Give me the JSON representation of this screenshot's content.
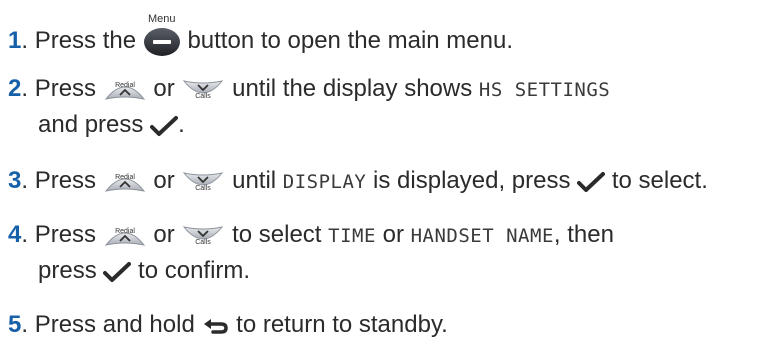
{
  "steps": [
    {
      "number": "1",
      "text_before": "Press the",
      "menu_caption": "Menu",
      "text_after": "button to open the main menu.",
      "icons": [
        "menu-button-icon"
      ]
    },
    {
      "number": "2",
      "text_press": "Press",
      "text_or": "or",
      "text_until": "until the display shows",
      "display_text": "HS SETTINGS",
      "line2_text": "and press",
      "line2_end": ".",
      "icons": [
        "redial-up-button-icon",
        "calls-down-button-icon",
        "ok-check-icon"
      ]
    },
    {
      "number": "3",
      "text_press": "Press",
      "text_or": "or",
      "text_until": "until",
      "display_text": "DISPLAY",
      "text_after": "is displayed, press",
      "text_end": "to select.",
      "icons": [
        "redial-up-button-icon",
        "calls-down-button-icon",
        "ok-check-icon"
      ]
    },
    {
      "number": "4",
      "text_press": "Press",
      "text_or": "or",
      "text_select": "to select",
      "display_text_1": "TIME",
      "text_or2": "or",
      "display_text_2": "HANDSET NAME",
      "text_then": ", then",
      "line2_text": "press",
      "line2_end": "to confirm.",
      "icons": [
        "redial-up-button-icon",
        "calls-down-button-icon",
        "ok-check-icon"
      ]
    },
    {
      "number": "5",
      "text_before": "Press and hold",
      "text_after": "to return to standby.",
      "icons": [
        "back-end-icon"
      ]
    }
  ],
  "button_labels": {
    "redial": "Redial",
    "calls": "Calls"
  },
  "colors": {
    "number": "#1560a8",
    "text": "#2b2b2b",
    "button_dark": "#3a3d44",
    "button_light": "#c9cdd3"
  }
}
